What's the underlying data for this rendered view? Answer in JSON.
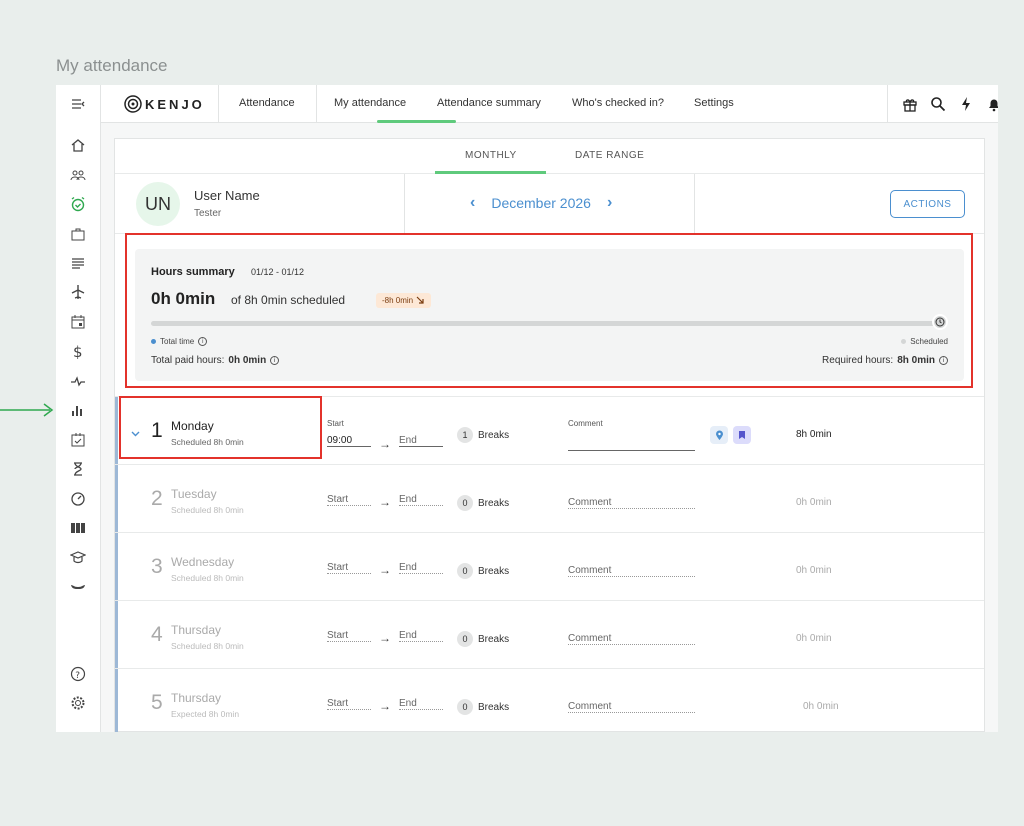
{
  "page_title": "My attendance",
  "logo": "KENJO",
  "nav": [
    "Attendance",
    "My attendance",
    "Attendance summary",
    "Who's checked in?",
    "Settings"
  ],
  "tabs": [
    "MONTHLY",
    "DATE RANGE"
  ],
  "user": {
    "initials": "UN",
    "name": "User Name",
    "role": "Tester"
  },
  "month": "December 2026",
  "actions_label": "ACTIONS",
  "summary": {
    "title": "Hours summary",
    "range": "01/12 - 01/12",
    "total": "0h 0min",
    "of_scheduled": "of 8h 0min scheduled",
    "diff_badge": "-8h 0min",
    "progress": 0,
    "legend_total": "Total time",
    "legend_scheduled": "Scheduled",
    "paid_label": "Total paid hours:",
    "paid_value": "0h 0min",
    "required_label": "Required hours:",
    "required_value": "8h 0min"
  },
  "labels": {
    "start": "Start",
    "end": "End",
    "breaks": "Breaks",
    "comment": "Comment"
  },
  "days": [
    {
      "num": "1",
      "name": "Monday",
      "sched": "Scheduled 8h 0min",
      "start": "09:00",
      "breaks": "1",
      "total": "8h 0min"
    },
    {
      "num": "2",
      "name": "Tuesday",
      "sched": "Scheduled 8h 0min",
      "breaks": "0",
      "total": "0h 0min"
    },
    {
      "num": "3",
      "name": "Wednesday",
      "sched": "Scheduled 8h 0min",
      "breaks": "0",
      "total": "0h 0min"
    },
    {
      "num": "4",
      "name": "Thursday",
      "sched": "Scheduled 8h 0min",
      "breaks": "0",
      "total": "0h 0min"
    },
    {
      "num": "5",
      "name": "Thursday",
      "sched": "Expected 8h 0min",
      "breaks": "0",
      "total": "0h 0min"
    }
  ],
  "colors": {
    "accent_green": "#5fca7c",
    "accent_blue": "#4b8fcf",
    "highlight_red": "#e3322b",
    "badge_bg": "#fde8d6"
  }
}
